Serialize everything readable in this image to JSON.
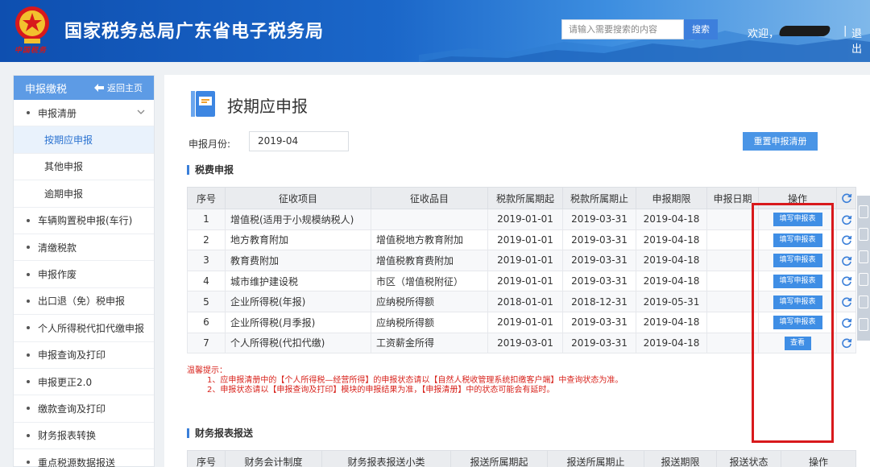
{
  "header": {
    "site_title": "国家税务总局广东省电子税务局",
    "emblem_text": "中国税务",
    "search_placeholder": "请输入需要搜索的内容",
    "search_button": "搜索",
    "welcome": "欢迎，",
    "separator": "|",
    "logout": "退出"
  },
  "sidebar": {
    "title": "申报缴税",
    "back_label": "返回主页",
    "items": [
      {
        "label": "申报清册",
        "type": "parent"
      },
      {
        "label": "按期应申报",
        "type": "sub",
        "active": true
      },
      {
        "label": "其他申报",
        "type": "sub"
      },
      {
        "label": "逾期申报",
        "type": "sub"
      },
      {
        "label": "车辆购置税申报(车行)",
        "type": "parent"
      },
      {
        "label": "清缴税款",
        "type": "parent"
      },
      {
        "label": "申报作废",
        "type": "parent"
      },
      {
        "label": "出口退（免）税申报",
        "type": "parent"
      },
      {
        "label": "个人所得税代扣代缴申报",
        "type": "parent"
      },
      {
        "label": "申报查询及打印",
        "type": "parent"
      },
      {
        "label": "申报更正2.0",
        "type": "parent"
      },
      {
        "label": "缴款查询及打印",
        "type": "parent"
      },
      {
        "label": "财务报表转换",
        "type": "parent"
      },
      {
        "label": "重点税源数据报送",
        "type": "parent"
      }
    ]
  },
  "main": {
    "page_title": "按期应申报",
    "month_label": "申报月份:",
    "month_value": "2019-04",
    "reset_button": "重置申报清册",
    "tax_section_title": "税费申报",
    "tax_table": {
      "headers": [
        "序号",
        "征收项目",
        "征收品目",
        "税款所属期起",
        "税款所属期止",
        "申报期限",
        "申报日期",
        "操作"
      ],
      "rows": [
        {
          "no": "1",
          "item": "增值税(适用于小规模纳税人)",
          "sub": "",
          "start": "2019-01-01",
          "end": "2019-03-31",
          "deadline": "2019-04-18",
          "date": "",
          "action": "填写申报表"
        },
        {
          "no": "2",
          "item": "地方教育附加",
          "sub": "增值税地方教育附加",
          "start": "2019-01-01",
          "end": "2019-03-31",
          "deadline": "2019-04-18",
          "date": "",
          "action": "填写申报表"
        },
        {
          "no": "3",
          "item": "教育费附加",
          "sub": "增值税教育费附加",
          "start": "2019-01-01",
          "end": "2019-03-31",
          "deadline": "2019-04-18",
          "date": "",
          "action": "填写申报表"
        },
        {
          "no": "4",
          "item": "城市维护建设税",
          "sub": "市区（增值税附征）",
          "start": "2019-01-01",
          "end": "2019-03-31",
          "deadline": "2019-04-18",
          "date": "",
          "action": "填写申报表"
        },
        {
          "no": "5",
          "item": "企业所得税(年报)",
          "sub": "应纳税所得额",
          "start": "2018-01-01",
          "end": "2018-12-31",
          "deadline": "2019-05-31",
          "date": "",
          "action": "填写申报表"
        },
        {
          "no": "6",
          "item": "企业所得税(月季报)",
          "sub": "应纳税所得额",
          "start": "2019-01-01",
          "end": "2019-03-31",
          "deadline": "2019-04-18",
          "date": "",
          "action": "填写申报表"
        },
        {
          "no": "7",
          "item": "个人所得税(代扣代缴)",
          "sub": "工资薪金所得",
          "start": "2019-03-01",
          "end": "2019-03-31",
          "deadline": "2019-04-18",
          "date": "",
          "action": "查看"
        }
      ]
    },
    "tips": {
      "title": "温馨提示：",
      "lines": [
        "1、应申报清册中的【个人所得税—经营所得】的申报状态请以【自然人税收管理系统扣缴客户端】中查询状态为准。",
        "2、申报状态请以【申报查询及打印】模块的申报结果为准，【申报清册】中的状态可能会有延时。"
      ]
    },
    "finance_section_title": "财务报表报送",
    "finance_table": {
      "headers": [
        "序号",
        "财务会计制度",
        "财务报表报送小类",
        "报送所属期起",
        "报送所属期止",
        "报送期限",
        "报送状态",
        "操作"
      ]
    }
  },
  "icons": [
    "emblem-icon",
    "back-arrow-icon",
    "chevron-down-icon",
    "page-icon",
    "refresh-icon"
  ],
  "colors": {
    "header_blue": "#1b67c9",
    "button_blue": "#3f8ee5",
    "sidebar_head": "#5d9be5",
    "tip_red": "#d8231c",
    "highlight_red": "#d8191c"
  }
}
